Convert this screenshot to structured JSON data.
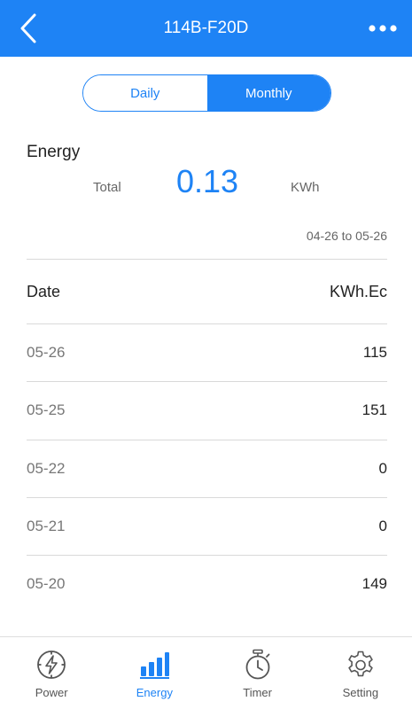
{
  "header": {
    "title": "114B-F20D"
  },
  "segment": {
    "daily_label": "Daily",
    "monthly_label": "Monthly",
    "selected": "Monthly"
  },
  "summary": {
    "heading": "Energy",
    "total_label": "Total",
    "total_value": "0.13",
    "unit": "KWh",
    "range": "04-26 to 05-26"
  },
  "table": {
    "col_date": "Date",
    "col_value": "KWh.Ec",
    "rows": [
      {
        "date": "05-26",
        "value": "115"
      },
      {
        "date": "05-25",
        "value": "151"
      },
      {
        "date": "05-22",
        "value": "0"
      },
      {
        "date": "05-21",
        "value": "0"
      },
      {
        "date": "05-20",
        "value": "149"
      }
    ]
  },
  "tabs": [
    {
      "label": "Power",
      "icon": "power-icon"
    },
    {
      "label": "Energy",
      "icon": "energy-icon"
    },
    {
      "label": "Timer",
      "icon": "timer-icon"
    },
    {
      "label": "Setting",
      "icon": "gear-icon"
    }
  ],
  "colors": {
    "accent": "#1e83f5",
    "header": "#1e83f5"
  }
}
